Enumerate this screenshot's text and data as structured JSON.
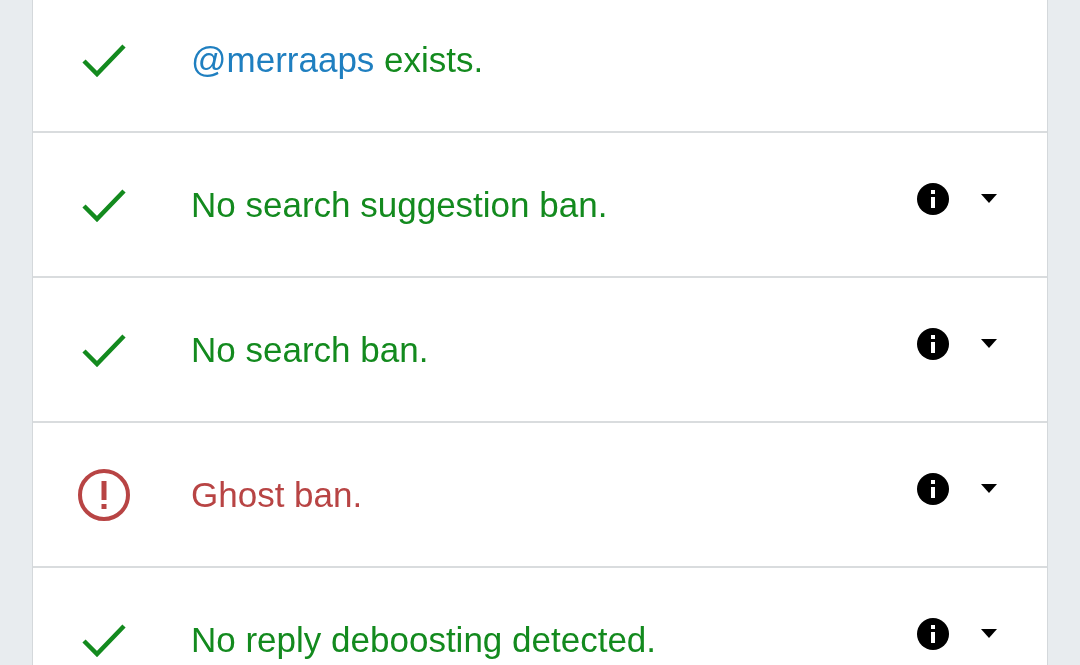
{
  "results": [
    {
      "kind": "ok",
      "link": "@merraaps",
      "text": "exists.",
      "info": false
    },
    {
      "kind": "ok",
      "text": "No search suggestion ban.",
      "info": true
    },
    {
      "kind": "ok",
      "text": "No search ban.",
      "info": true
    },
    {
      "kind": "error",
      "text": "Ghost ban.",
      "info": true
    },
    {
      "kind": "ok",
      "text": "No reply deboosting detected.",
      "info": true
    }
  ]
}
